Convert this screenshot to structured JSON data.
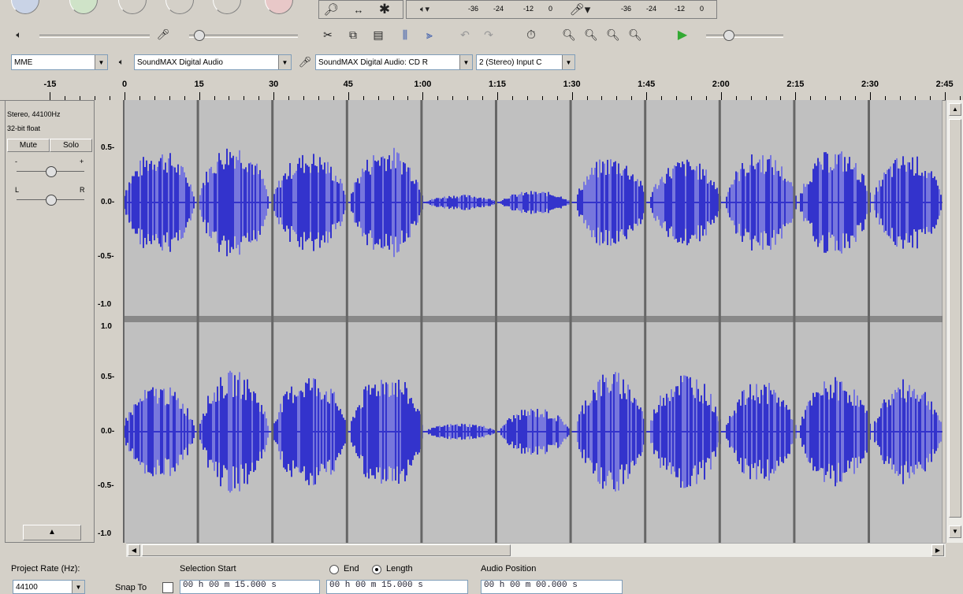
{
  "toolbar": {
    "zoom_icons": [
      "magnifier-icon",
      "double-arrow-icon",
      "asterisk-icon"
    ],
    "meter1_labels": [
      "-36",
      "-24",
      "-12",
      "0"
    ],
    "meter2_labels": [
      "-36",
      "-24",
      "-12",
      "0"
    ],
    "host_select": "MME",
    "output_device": "SoundMAX Digital Audio",
    "input_device": "SoundMAX Digital Audio: CD R",
    "channels": "2 (Stereo) Input C"
  },
  "ruler": {
    "labels": [
      "-15",
      "0",
      "15",
      "30",
      "45",
      "1:00",
      "1:15",
      "1:30",
      "1:45",
      "2:00",
      "2:15",
      "2:30",
      "2:45"
    ]
  },
  "track": {
    "info_line1": "Stereo, 44100Hz",
    "info_line2": "32-bit float",
    "mute_label": "Mute",
    "solo_label": "Solo",
    "gain_minus": "-",
    "gain_plus": "+",
    "pan_left": "L",
    "pan_right": "R",
    "top_scale": [
      "0.5-",
      "0.0-",
      "-0.5-",
      "-1.0"
    ],
    "bottom_scale": [
      "1.0",
      "0.5-",
      "0.0-",
      "-0.5-",
      "-1.0"
    ],
    "wave_color": "#3333cc",
    "wave_light": "#7777dd"
  },
  "status": {
    "project_rate_label": "Project Rate (Hz):",
    "project_rate_value": "44100",
    "snap_label": "Snap To",
    "selection_start_label": "Selection Start",
    "end_label": "End",
    "length_label": "Length",
    "audio_position_label": "Audio Position",
    "sel_start_value": "00 h 00 m 15.000 s",
    "length_value": "00 h 00 m 15.000 s",
    "audio_pos_value": "00 h 00 m 00.000 s"
  }
}
